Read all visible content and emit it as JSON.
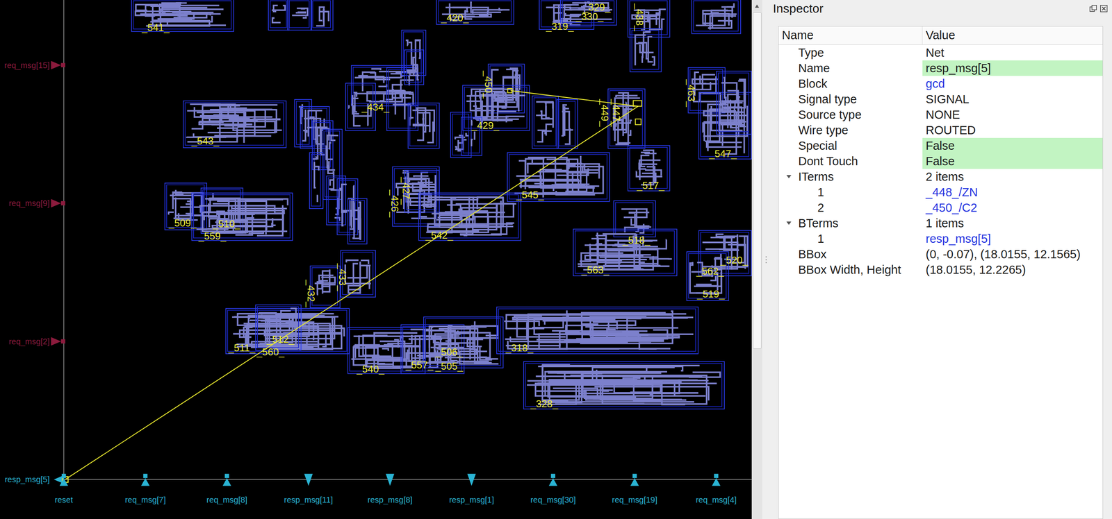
{
  "layout": {
    "left_pins": [
      {
        "label": "req_msg[15]",
        "direction": "input",
        "selected": false,
        "color": "#8c1b3d"
      },
      {
        "label": "req_msg[9]",
        "direction": "input",
        "selected": false,
        "color": "#8c1b3d"
      },
      {
        "label": "req_msg[2]",
        "direction": "input",
        "selected": false,
        "color": "#8c1b3d"
      },
      {
        "label": "resp_msg[5]",
        "direction": "output",
        "selected": true,
        "color": "#2ab4d4"
      }
    ],
    "bottom_pins": [
      {
        "label": "reset",
        "direction": "input",
        "selected": false,
        "color": "#2ab4d4"
      },
      {
        "label": "req_msg[7]",
        "direction": "input",
        "selected": false,
        "color": "#2ab4d4"
      },
      {
        "label": "req_msg[8]",
        "direction": "input",
        "selected": false,
        "color": "#2ab4d4"
      },
      {
        "label": "resp_msg[11]",
        "direction": "output",
        "selected": false,
        "color": "#2ab4d4"
      },
      {
        "label": "resp_msg[8]",
        "direction": "output",
        "selected": false,
        "color": "#2ab4d4"
      },
      {
        "label": "resp_msg[1]",
        "direction": "output",
        "selected": false,
        "color": "#2ab4d4"
      },
      {
        "label": "req_msg[30]",
        "direction": "input",
        "selected": false,
        "color": "#2ab4d4"
      },
      {
        "label": "req_msg[19]",
        "direction": "input",
        "selected": false,
        "color": "#2ab4d4"
      },
      {
        "label": "req_msg[4]",
        "direction": "input",
        "selected": false,
        "color": "#2ab4d4"
      }
    ],
    "cells": [
      {
        "label": "_541_",
        "vertical": false
      },
      {
        "label": "_420_",
        "vertical": false
      },
      {
        "label": "_319_",
        "vertical": false
      },
      {
        "label": "_330_",
        "vertical": false
      },
      {
        "label": "_329_",
        "vertical": false
      },
      {
        "label": "_438_",
        "vertical": true
      },
      {
        "label": "_434_",
        "vertical": false
      },
      {
        "label": "_543_",
        "vertical": false
      },
      {
        "label": "_450_",
        "vertical": true
      },
      {
        "label": "_429_",
        "vertical": false
      },
      {
        "label": "_449_",
        "vertical": true
      },
      {
        "label": "_447_",
        "vertical": true
      },
      {
        "label": "_463_",
        "vertical": true
      },
      {
        "label": "_547_",
        "vertical": false
      },
      {
        "label": "_517_",
        "vertical": false
      },
      {
        "label": "_545_",
        "vertical": false
      },
      {
        "label": "_427_",
        "vertical": true
      },
      {
        "label": "_426_",
        "vertical": true
      },
      {
        "label": "_542_",
        "vertical": false
      },
      {
        "label": "_509_",
        "vertical": false
      },
      {
        "label": "_510_",
        "vertical": false
      },
      {
        "label": "_559_",
        "vertical": false
      },
      {
        "label": "_518_",
        "vertical": false
      },
      {
        "label": "_563_",
        "vertical": false
      },
      {
        "label": "_562_",
        "vertical": false
      },
      {
        "label": "_520_",
        "vertical": false
      },
      {
        "label": "_519_",
        "vertical": false
      },
      {
        "label": "_433_",
        "vertical": true
      },
      {
        "label": "_432_",
        "vertical": true
      },
      {
        "label": "_511_",
        "vertical": false
      },
      {
        "label": "_512_",
        "vertical": false
      },
      {
        "label": "_560_",
        "vertical": false
      },
      {
        "label": "_540_",
        "vertical": false
      },
      {
        "label": "_557_",
        "vertical": false
      },
      {
        "label": "_506_",
        "vertical": false
      },
      {
        "label": "_505_",
        "vertical": false
      },
      {
        "label": "_318_",
        "vertical": false
      },
      {
        "label": "_328_",
        "vertical": false
      }
    ]
  },
  "inspector": {
    "title": "Inspector",
    "columns": [
      "Name",
      "Value"
    ],
    "rows": [
      {
        "name": "Type",
        "value": "Net",
        "kind": "field",
        "nested": false,
        "highlighted": false
      },
      {
        "name": "Name",
        "value": "resp_msg[5]",
        "kind": "field",
        "nested": false,
        "highlighted": true
      },
      {
        "name": "Block",
        "value": "gcd",
        "kind": "link",
        "nested": false,
        "highlighted": false
      },
      {
        "name": "Signal type",
        "value": "SIGNAL",
        "kind": "field",
        "nested": false,
        "highlighted": false
      },
      {
        "name": "Source type",
        "value": "NONE",
        "kind": "field",
        "nested": false,
        "highlighted": false
      },
      {
        "name": "Wire type",
        "value": "ROUTED",
        "kind": "field",
        "nested": false,
        "highlighted": false
      },
      {
        "name": "Special",
        "value": "False",
        "kind": "field",
        "nested": false,
        "highlighted": true
      },
      {
        "name": "Dont Touch",
        "value": "False",
        "kind": "field",
        "nested": false,
        "highlighted": true
      },
      {
        "name": "ITerms",
        "value": "2 items",
        "kind": "group",
        "nested": false,
        "highlighted": false,
        "expanded": true
      },
      {
        "name": "1",
        "value": "_448_/ZN",
        "kind": "link",
        "nested": true,
        "highlighted": false
      },
      {
        "name": "2",
        "value": "_450_/C2",
        "kind": "link",
        "nested": true,
        "highlighted": false
      },
      {
        "name": "BTerms",
        "value": "1 items",
        "kind": "group",
        "nested": false,
        "highlighted": false,
        "expanded": true
      },
      {
        "name": "1",
        "value": "resp_msg[5]",
        "kind": "link",
        "nested": true,
        "highlighted": false
      },
      {
        "name": "BBox",
        "value": "(0, -0.07), (18.0155, 12.1565)",
        "kind": "field",
        "nested": false,
        "highlighted": false
      },
      {
        "name": "BBox Width, Height",
        "value": "(18.0155, 12.2265)",
        "kind": "field",
        "nested": false,
        "highlighted": false
      }
    ]
  }
}
